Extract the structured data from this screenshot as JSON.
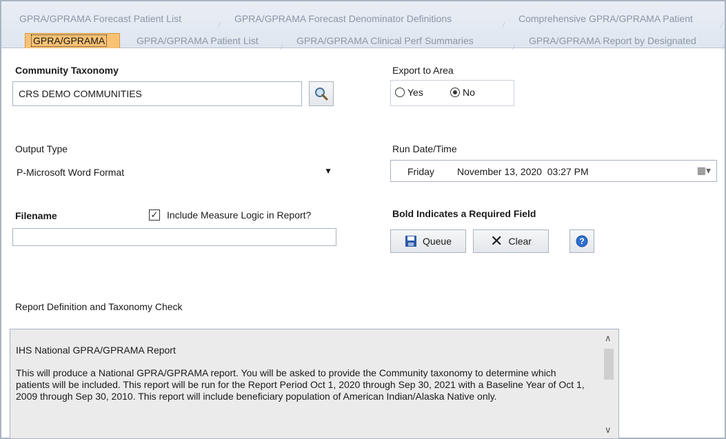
{
  "tabs_row1": [
    "GPRA/GPRAMA Forecast Patient List",
    "GPRA/GPRAMA Forecast Denominator Definitions",
    "Comprehensive GPRA/GPRAMA Patient"
  ],
  "tabs_row2": [
    "GPRA/GPRAMA",
    "GPRA/GPRAMA Patient List",
    "GPRA/GPRAMA Clinical Perf Summaries",
    "GPRA/GPRAMA Report by Designated"
  ],
  "community": {
    "label": "Community Taxonomy",
    "value": "CRS DEMO COMMUNITIES"
  },
  "export": {
    "label": "Export to Area",
    "yes": "Yes",
    "no": "No",
    "selected": "No"
  },
  "output": {
    "label": "Output Type",
    "value": "P-Microsoft Word Format"
  },
  "rundate": {
    "label": "Run Date/Time",
    "day": "Friday",
    "date": "November 13, 2020  03:27 PM"
  },
  "filename": {
    "label": "Filename",
    "value": "",
    "include_logic_label": "Include Measure Logic in Report?",
    "include_logic_checked": true
  },
  "required_note": "Bold Indicates a Required Field",
  "buttons": {
    "queue": "Queue",
    "clear": "Clear"
  },
  "report_def": {
    "label": "Report Definition and Taxonomy Check",
    "title": "IHS National GPRA/GPRAMA Report",
    "body": "This will produce a National GPRA/GPRAMA report.  You will be asked to provide the Community taxonomy to determine which patients will be included.  This report will be run for the Report Period Oct 1, 2020 through Sep 30, 2021 with a Baseline Year of Oct 1, 2009 through Sep 30, 2010. This report will include beneficiary population of American Indian/Alaska Native only."
  }
}
